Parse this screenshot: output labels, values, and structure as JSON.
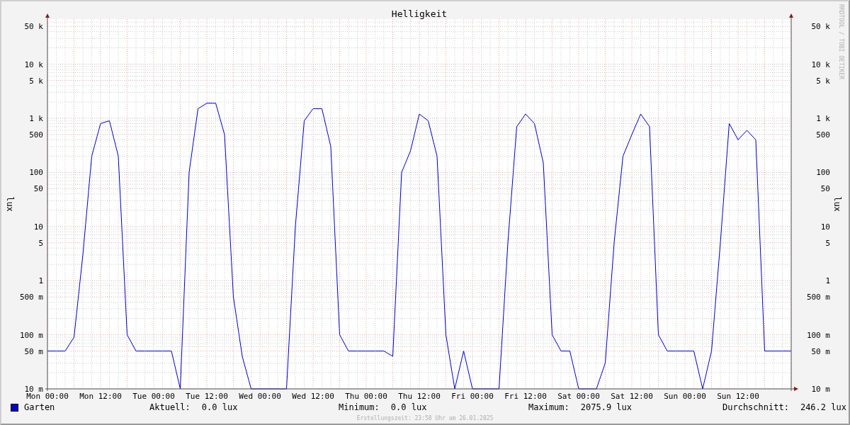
{
  "chart": {
    "title": "Helligkeit",
    "ylabel": "lux",
    "y_tick_labels": [
      "50 k",
      "10 k",
      "5 k",
      "1 k",
      "500",
      "100",
      "50",
      "10",
      "5",
      "1",
      "500 m",
      "100 m",
      "50 m",
      "10 m"
    ],
    "x_tick_labels": [
      "Mon 00:00",
      "Mon 12:00",
      "Tue 00:00",
      "Tue 12:00",
      "Wed 00:00",
      "Wed 12:00",
      "Thu 00:00",
      "Thu 12:00",
      "Fri 00:00",
      "Fri 12:00",
      "Sat 00:00",
      "Sat 12:00",
      "Sun 00:00",
      "Sun 12:00"
    ],
    "right_axis": {
      "label": "lux",
      "tick_labels": [
        "50 k",
        "10 k",
        "5 k",
        "1 k",
        "500",
        "100",
        "50",
        "10",
        "5",
        "1",
        "500 m",
        "100 m",
        "50 m",
        "10 m"
      ]
    },
    "credit": "RRDTOOL / TOBI OETIKER"
  },
  "legend": [
    {
      "name": "Garten",
      "color": "#0000cc"
    }
  ],
  "stats": [
    {
      "label": "Aktuell:",
      "value": "0.0 lux"
    },
    {
      "label": "Minimum:",
      "value": "0.0 lux"
    },
    {
      "label": "Maximum:",
      "value": "2075.9 lux"
    },
    {
      "label": "Durchschnitt:",
      "value": "246.2 lux"
    }
  ],
  "footer": "Erstellungszeit: 23:58 Uhr am 26.01.2025"
}
